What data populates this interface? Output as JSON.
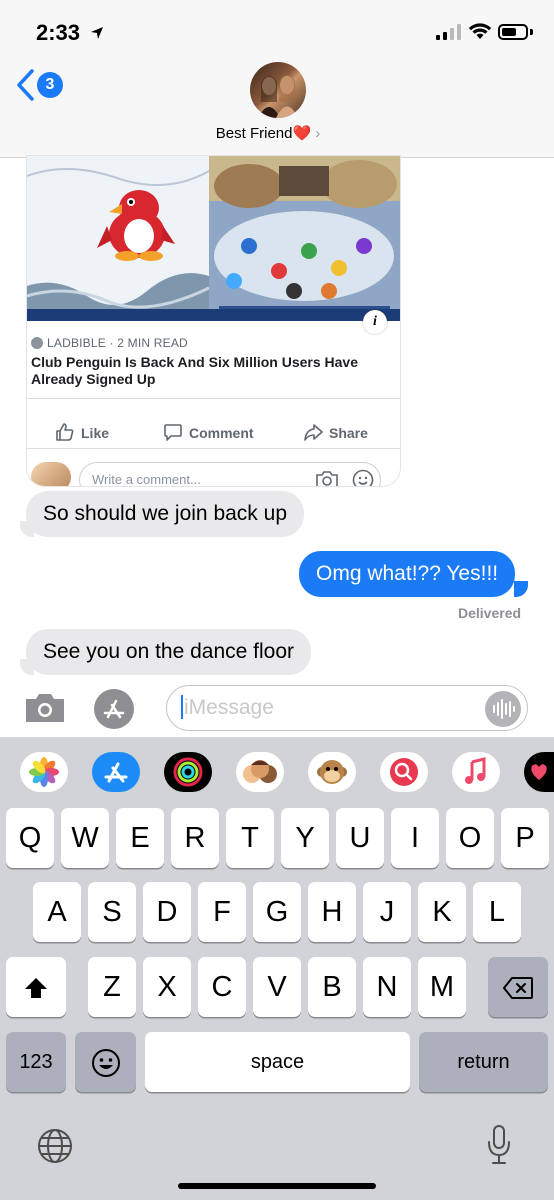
{
  "status_bar": {
    "time": "2:33"
  },
  "header": {
    "back_badge": "3",
    "contact_name": "Best Friend",
    "contact_emoji": "❤️",
    "chevron": "›"
  },
  "link_card": {
    "source": "LADBIBLE · 2 MIN READ",
    "headline": "Club Penguin Is Back And Six Million Users Have Already Signed Up",
    "actions": {
      "like": "Like",
      "comment": "Comment",
      "share": "Share"
    },
    "comment_placeholder": "Write a comment...",
    "info_icon_label": "i"
  },
  "messages": [
    {
      "direction": "received",
      "text": "So should we join back up"
    },
    {
      "direction": "sent",
      "text": "Omg what!?? Yes!!!"
    },
    {
      "direction": "received",
      "text": "See you on the dance floor"
    }
  ],
  "delivery_status": "Delivered",
  "input": {
    "placeholder": "iMessage"
  },
  "app_drawer": [
    "photos-icon",
    "app-store-icon",
    "activity-icon",
    "memoji-icon",
    "animoji-icon",
    "web-search-icon",
    "music-icon",
    "digital-touch-icon"
  ],
  "keyboard": {
    "row1": [
      "Q",
      "W",
      "E",
      "R",
      "T",
      "Y",
      "U",
      "I",
      "O",
      "P"
    ],
    "row2": [
      "A",
      "S",
      "D",
      "F",
      "G",
      "H",
      "J",
      "K",
      "L"
    ],
    "row3": [
      "Z",
      "X",
      "C",
      "V",
      "B",
      "N",
      "M"
    ],
    "numbers_key": "123",
    "space_key": "space",
    "return_key": "return"
  },
  "colors": {
    "imessage_blue": "#1b7af6",
    "received_bubble": "#e9e9eb",
    "keyboard_bg": "#d1d3d9"
  }
}
